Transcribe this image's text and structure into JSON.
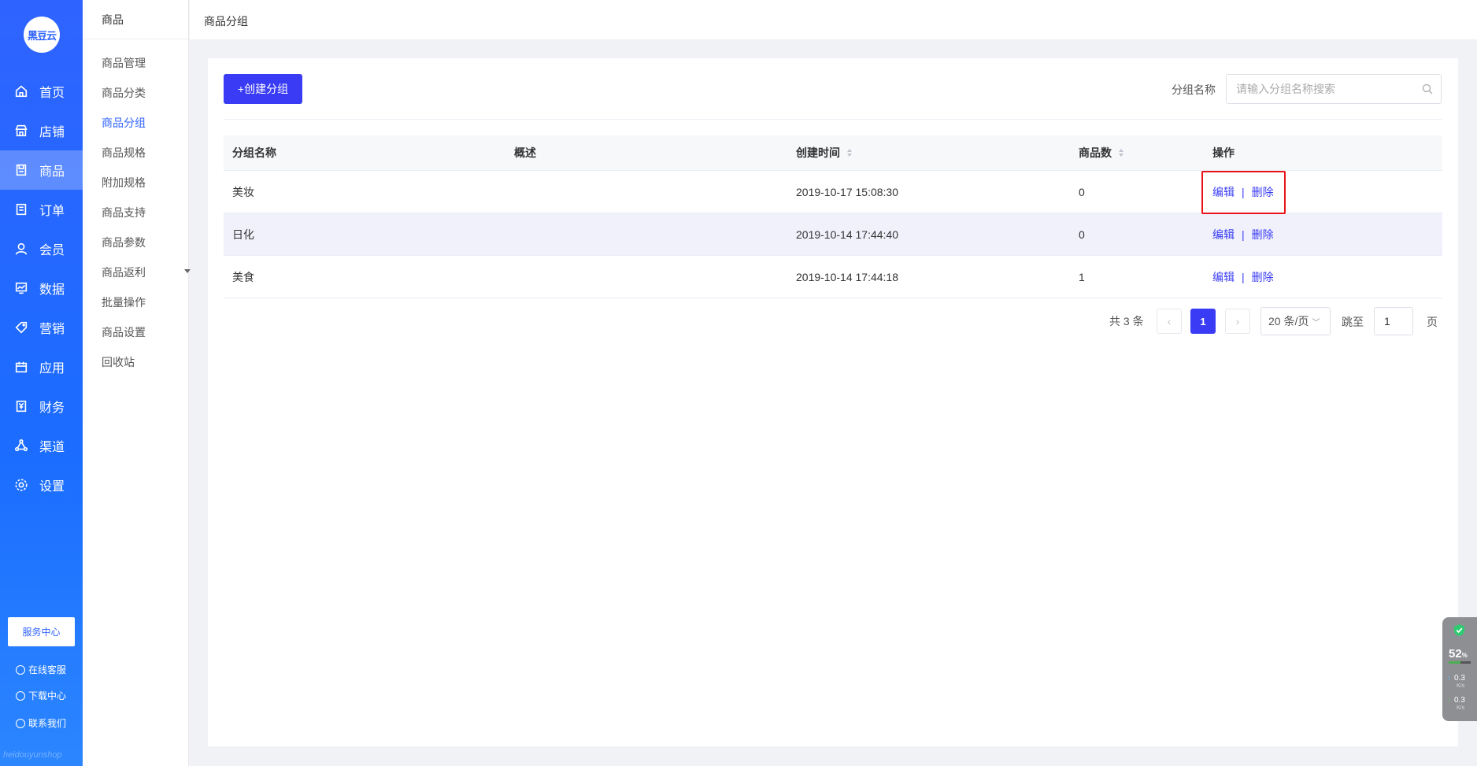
{
  "app": {
    "logo_text": "黑豆云",
    "watermark": "heidouyunshop"
  },
  "main_nav": {
    "items": [
      {
        "label": "首页",
        "icon": "home-icon"
      },
      {
        "label": "店铺",
        "icon": "store-icon"
      },
      {
        "label": "商品",
        "icon": "goods-icon",
        "active": true
      },
      {
        "label": "订单",
        "icon": "order-icon"
      },
      {
        "label": "会员",
        "icon": "member-icon"
      },
      {
        "label": "数据",
        "icon": "chart-icon"
      },
      {
        "label": "营销",
        "icon": "tag-icon"
      },
      {
        "label": "应用",
        "icon": "app-icon"
      },
      {
        "label": "财务",
        "icon": "finance-icon"
      },
      {
        "label": "渠道",
        "icon": "channel-icon"
      },
      {
        "label": "设置",
        "icon": "gear-icon"
      }
    ],
    "service_center": "服务中心",
    "links": [
      "在线客服",
      "下载中心",
      "联系我们"
    ]
  },
  "sub_nav": {
    "title": "商品",
    "items": [
      "商品管理",
      "商品分类",
      "商品分组",
      "商品规格",
      "附加规格",
      "商品支持",
      "商品参数",
      "商品返利",
      "批量操作",
      "商品设置",
      "回收站"
    ],
    "active_index": 2
  },
  "header": {
    "breadcrumb": "商品分组"
  },
  "toolbar": {
    "create_label": "+创建分组",
    "search_label": "分组名称",
    "search_placeholder": "请输入分组名称搜索",
    "search_value": ""
  },
  "table": {
    "columns": [
      "分组名称",
      "概述",
      "创建时间",
      "商品数",
      "操作"
    ],
    "rows": [
      {
        "name": "美妆",
        "desc": "",
        "created": "2019-10-17 15:08:30",
        "count": "0"
      },
      {
        "name": "日化",
        "desc": "",
        "created": "2019-10-14 17:44:40",
        "count": "0"
      },
      {
        "name": "美食",
        "desc": "",
        "created": "2019-10-14 17:44:18",
        "count": "1"
      }
    ],
    "edit_label": "编辑",
    "delete_label": "删除",
    "separator": "|"
  },
  "pagination": {
    "total_text": "共 3 条",
    "prev": "‹",
    "next": "›",
    "current_page": "1",
    "page_size": "20 条/页",
    "goto_label": "跳至",
    "goto_value": "1",
    "page_suffix": "页"
  },
  "float_widget": {
    "percent": "52",
    "percent_unit": "%",
    "up_speed": "0.3",
    "down_speed": "0.3",
    "speed_unit": "K/s"
  },
  "colors": {
    "primary": "#3a3cf5",
    "sidebar": "#2f63ff",
    "highlight_box": "#e8141a"
  }
}
